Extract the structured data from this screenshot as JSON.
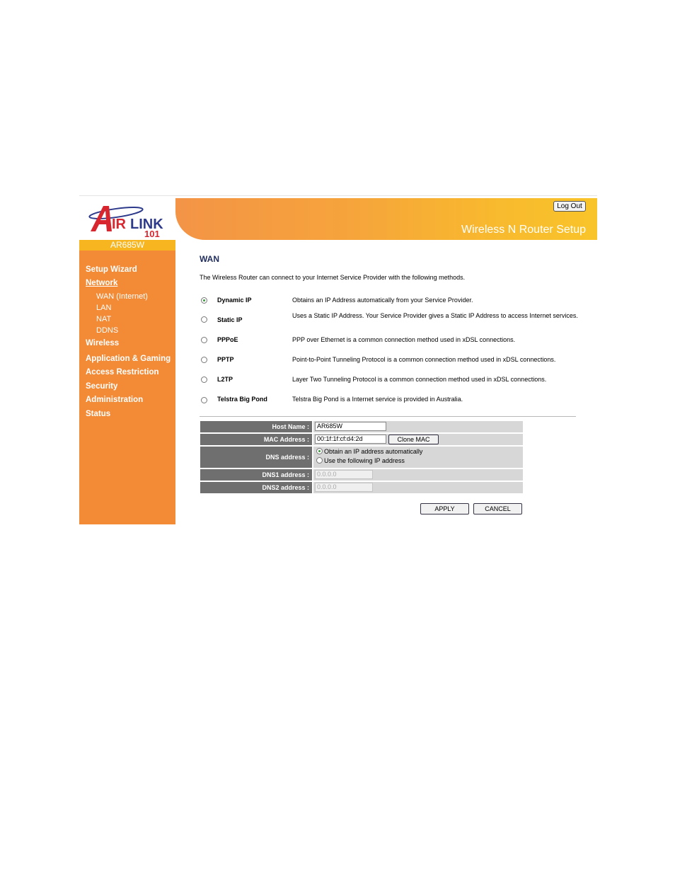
{
  "brand": {
    "logo_text": "AIRLINK 101",
    "model": "AR685W",
    "product_title": "Wireless N Router Setup",
    "logout_label": "Log Out",
    "colors": {
      "sidebar": "#f28a36",
      "banner_start": "#f39446",
      "banner_end": "#f9c42a",
      "model_bar": "#f7b520"
    }
  },
  "sidebar": {
    "items": [
      {
        "label": "Setup Wizard"
      },
      {
        "label": "Network",
        "active": true
      },
      {
        "label": "WAN (Internet)",
        "sub": true
      },
      {
        "label": "LAN",
        "sub": true
      },
      {
        "label": "NAT",
        "sub": true
      },
      {
        "label": "DDNS",
        "sub": true
      },
      {
        "label": "Wireless"
      },
      {
        "label": "Application & Gaming"
      },
      {
        "label": "Access Restriction"
      },
      {
        "label": "Security"
      },
      {
        "label": "Administration"
      },
      {
        "label": "Status"
      }
    ]
  },
  "main": {
    "title": "WAN",
    "intro": "The Wireless Router can connect to your Internet Service Provider with the following methods.",
    "methods": [
      {
        "label": "Dynamic IP",
        "desc": "Obtains an IP Address automatically from your Service Provider.",
        "selected": true
      },
      {
        "label": "Static IP",
        "desc": "Uses a Static IP Address. Your Service Provider gives a Static IP Address to access Internet services.",
        "selected": false
      },
      {
        "label": "PPPoE",
        "desc": "PPP over Ethernet is a common connection method used in xDSL connections.",
        "selected": false
      },
      {
        "label": "PPTP",
        "desc": "Point-to-Point Tunneling Protocol is a common connection method used in xDSL connections.",
        "selected": false
      },
      {
        "label": "L2TP",
        "desc": "Layer Two Tunneling Protocol is a common connection method used in xDSL connections.",
        "selected": false
      },
      {
        "label": "Telstra Big Pond",
        "desc": "Telstra Big Pond is a Internet service is provided in Australia.",
        "selected": false
      }
    ]
  },
  "form": {
    "host_name_label": "Host Name :",
    "host_name_value": "AR685W",
    "mac_label": "MAC Address :",
    "mac_value": "00:1f:1f:cf:d4:2d",
    "clone_mac_label": "Clone MAC",
    "dns_label": "DNS address :",
    "dns_auto_label": "Obtain an IP address automatically",
    "dns_manual_label": "Use the following IP address",
    "dns_auto_selected": true,
    "dns1_label": "DNS1 address :",
    "dns1_value": "0.0.0.0",
    "dns2_label": "DNS2 address :",
    "dns2_value": "0.0.0.0"
  },
  "actions": {
    "apply_label": "APPLY",
    "cancel_label": "CANCEL"
  }
}
